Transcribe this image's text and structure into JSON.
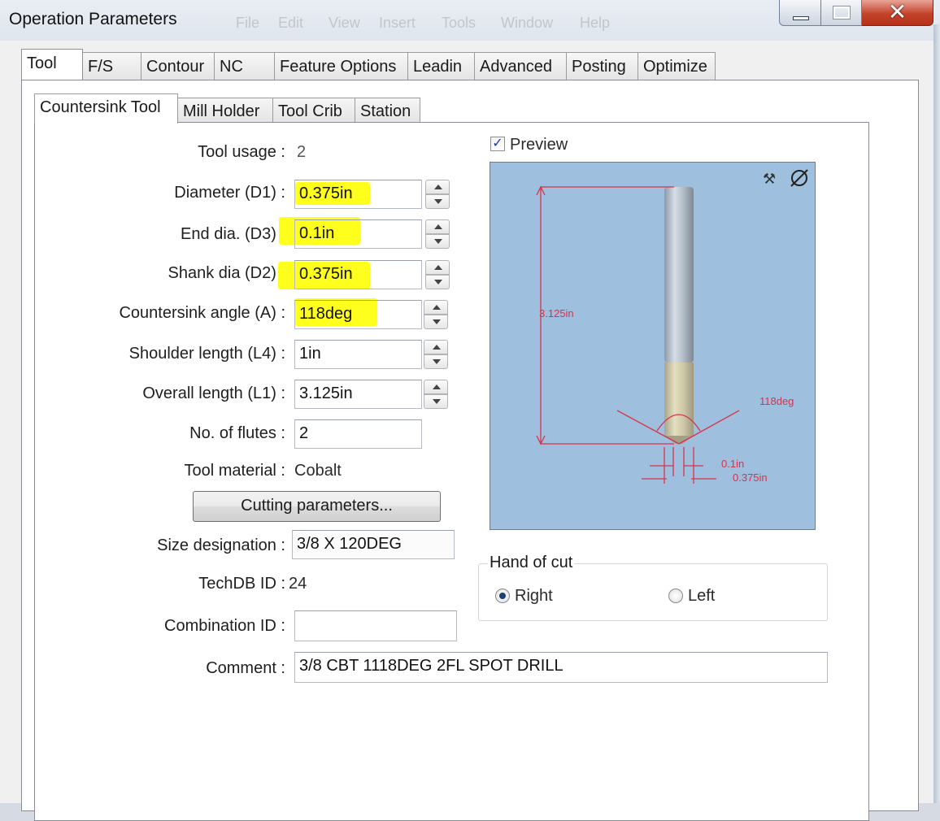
{
  "window": {
    "title": "Operation Parameters",
    "menu_ghost": [
      "File",
      "Edit",
      "View",
      "Insert",
      "Tools",
      "Window",
      "Help"
    ]
  },
  "tabs": [
    "Tool",
    "F/S",
    "Contour",
    "NC",
    "Feature Options",
    "Leadin",
    "Advanced",
    "Posting",
    "Optimize"
  ],
  "subtabs": [
    "Countersink Tool",
    "Mill Holder",
    "Tool Crib",
    "Station"
  ],
  "form": {
    "tool_usage": {
      "label": "Tool usage :",
      "value": "2"
    },
    "diameter": {
      "label": "Diameter (D1) :",
      "value": "0.375in",
      "highlighted": true
    },
    "end_dia": {
      "label": "End dia. (D3) :",
      "value": "0.1in",
      "highlighted": true
    },
    "shank_dia": {
      "label": "Shank dia (D2) :",
      "value": "0.375in",
      "highlighted": true
    },
    "countersink_angle": {
      "label": "Countersink angle (A) :",
      "value": "118deg",
      "highlighted": true
    },
    "shoulder_length": {
      "label": "Shoulder length (L4) :",
      "value": "1in"
    },
    "overall_length": {
      "label": "Overall length (L1) :",
      "value": "3.125in"
    },
    "flutes": {
      "label": "No. of flutes :",
      "value": "2"
    },
    "tool_material": {
      "label": "Tool material :",
      "value": "Cobalt"
    },
    "cutting_button": "Cutting parameters...",
    "size_designation": {
      "label": "Size designation :",
      "value": "3/8 X 120DEG"
    },
    "techdb_id": {
      "label": "TechDB ID :",
      "value": "24"
    },
    "combination_id": {
      "label": "Combination ID :",
      "value": ""
    },
    "comment": {
      "label": "Comment :",
      "value": "3/8 CBT 1118DEG 2FL SPOT DRILL"
    }
  },
  "preview": {
    "checkbox_label": "Preview",
    "checked": true,
    "background": "#9fbfde",
    "dim_color": "#d8324a",
    "labels": {
      "overall": "3.125in",
      "angle": "118deg",
      "end_dia": "0.1in",
      "diameter": "0.375in"
    }
  },
  "hand_of_cut": {
    "title": "Hand of cut",
    "options": [
      "Right",
      "Left"
    ],
    "selected": "Right"
  },
  "colors": {
    "highlight": "#ffff1e",
    "close_button": "#c4432b"
  }
}
